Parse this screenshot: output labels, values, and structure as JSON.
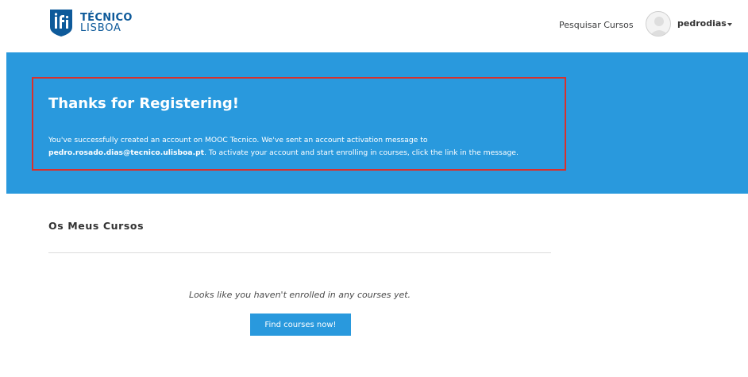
{
  "header": {
    "logo_line1": "TÉCNICO",
    "logo_line2": "LISBOA",
    "search_courses_label": "Pesquisar Cursos",
    "username": "pedrodias",
    "icons": {
      "logo": "tecnico-logo-icon",
      "avatar": "user-avatar-icon",
      "dropdown": "caret-down-icon"
    }
  },
  "banner": {
    "title": "Thanks for Registering!",
    "message_part1": "You've successfully created an account on MOOC Tecnico. We've sent an account activation message to",
    "email": "pedro.rosado.dias@tecnico.ulisboa.pt",
    "message_part2": ". To activate your account and start enrolling in courses, click the link in the message."
  },
  "courses": {
    "section_title": "Os Meus Cursos",
    "empty_message": "Looks like you haven't enrolled in any courses yet.",
    "find_button_label": "Find courses now!"
  },
  "colors": {
    "primary_blue": "#2999dd",
    "logo_blue": "#0e5a9a",
    "highlight_red": "#d9302c"
  }
}
